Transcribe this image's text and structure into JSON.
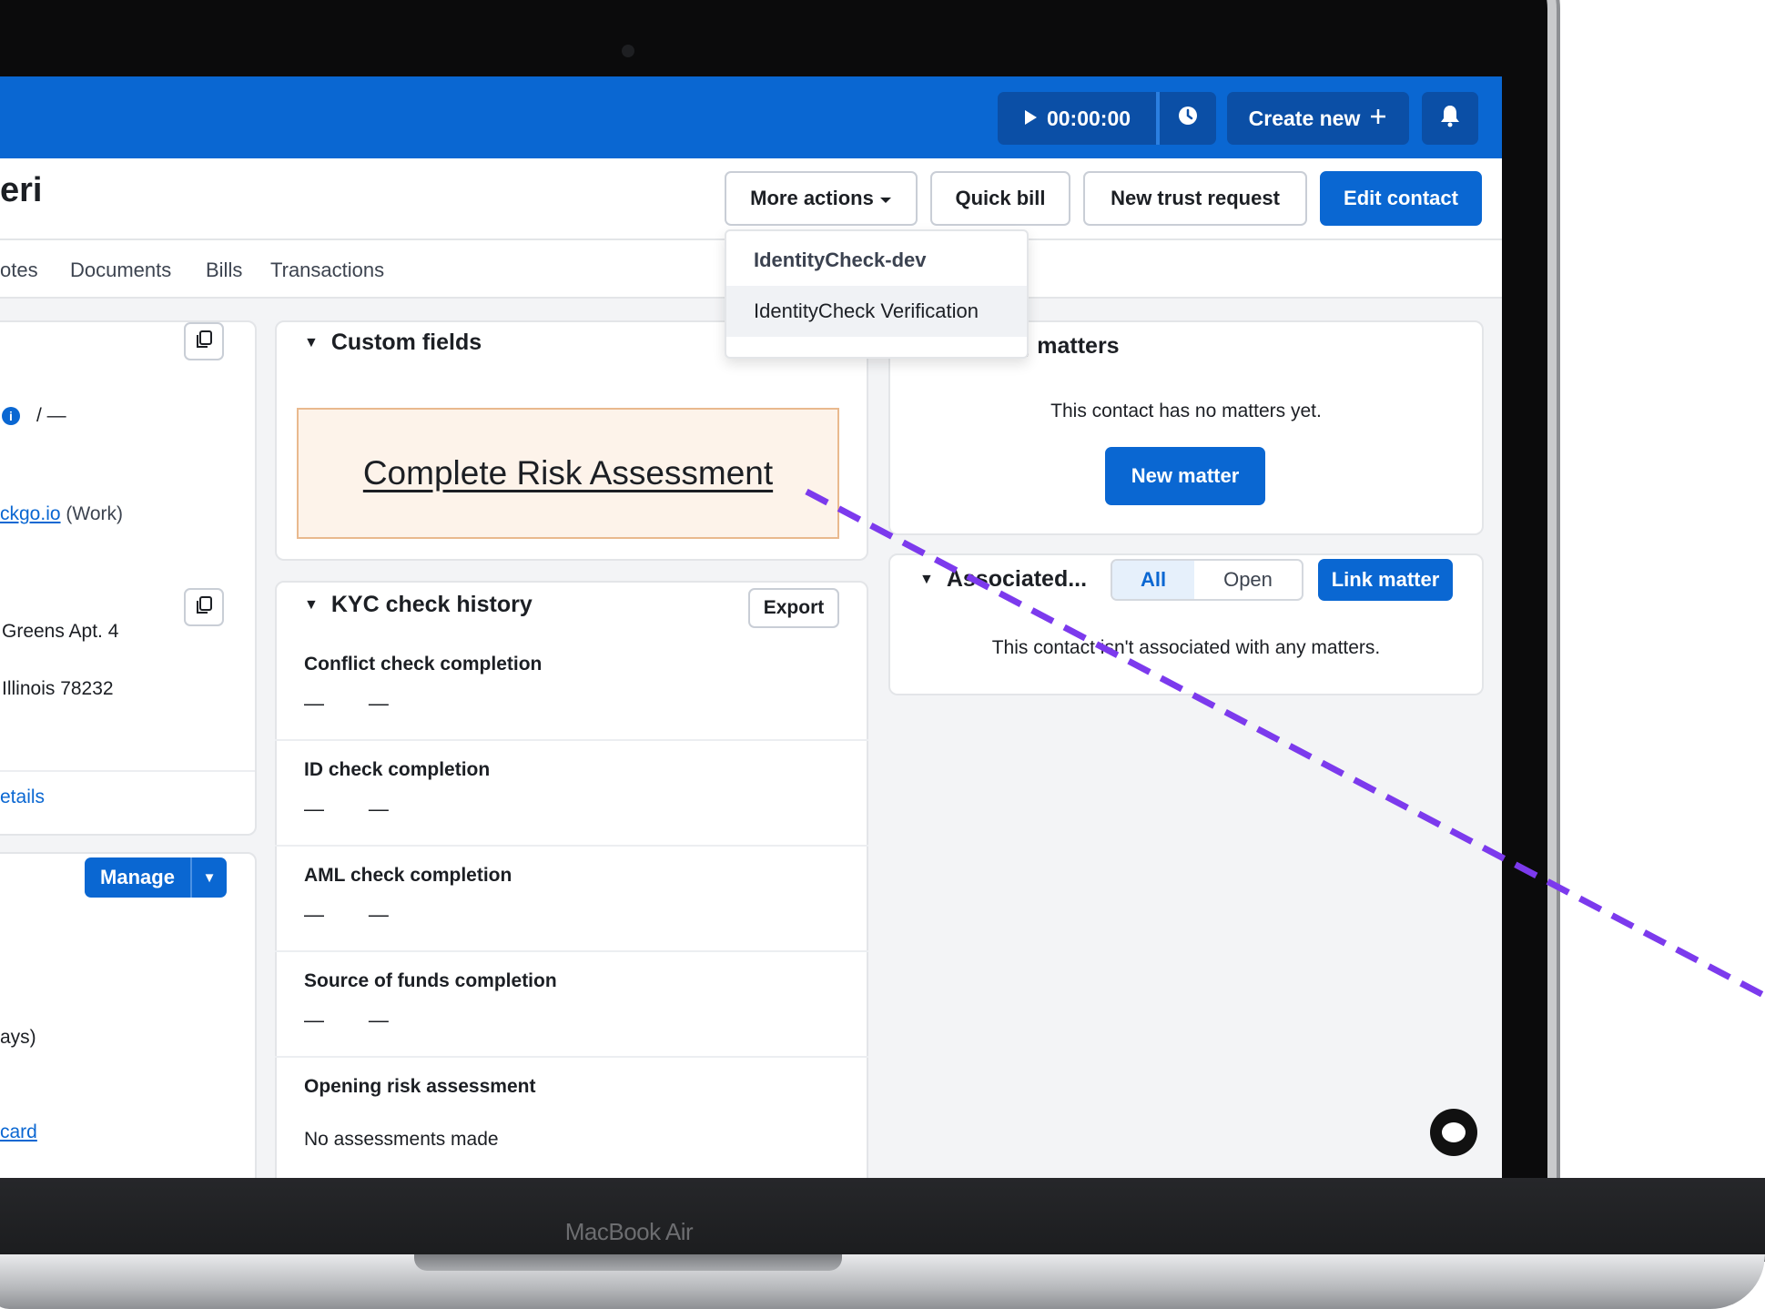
{
  "device": {
    "label": "MacBook Air"
  },
  "topbar": {
    "timer": "00:00:00",
    "create_new": "Create new",
    "icons": [
      "play-icon",
      "clock-icon",
      "plus-icon",
      "bell-icon"
    ]
  },
  "header": {
    "contact_name": "eri",
    "more_actions": "More actions",
    "quick_bill": "Quick bill",
    "new_trust_request": "New trust request",
    "edit_contact": "Edit contact"
  },
  "tabs": [
    "otes",
    "Documents",
    "Bills",
    "Transactions"
  ],
  "dropdown": {
    "items": [
      "IdentityCheck-dev",
      "IdentityCheck Verification"
    ]
  },
  "left_panel": {
    "info_value": "/ —",
    "email_link": "ckgo.io",
    "email_type": "(Work)",
    "address_line1": "Greens Apt. 4",
    "address_line2": "Illinois 78232",
    "details_link": "etails",
    "manage": "Manage",
    "days_text": "ays)",
    "card_link": "card"
  },
  "custom_fields": {
    "title": "Custom fields",
    "risk_link": "Complete Risk Assessment"
  },
  "kyc": {
    "title": "KYC check history",
    "export": "Export",
    "rows": [
      {
        "label": "Conflict check completion",
        "value": "—        —"
      },
      {
        "label": "ID check completion",
        "value": "—        —"
      },
      {
        "label": "AML check completion",
        "value": "—        —"
      },
      {
        "label": "Source of funds completion",
        "value": "—        —"
      },
      {
        "label": "Opening risk assessment",
        "value": "No assessments made"
      }
    ]
  },
  "matters": {
    "title": "; matters",
    "empty_text": "This contact has no matters yet.",
    "new_matter": "New matter"
  },
  "associated": {
    "title": "Associated...",
    "filter_all": "All",
    "filter_open": "Open",
    "link_matter": "Link matter",
    "empty_text": "This contact isn't associated with any matters."
  },
  "colors": {
    "brand_blue": "#0a67d2",
    "dashed_line": "#7c3aed",
    "risk_box_bg": "#fdf3ea"
  }
}
